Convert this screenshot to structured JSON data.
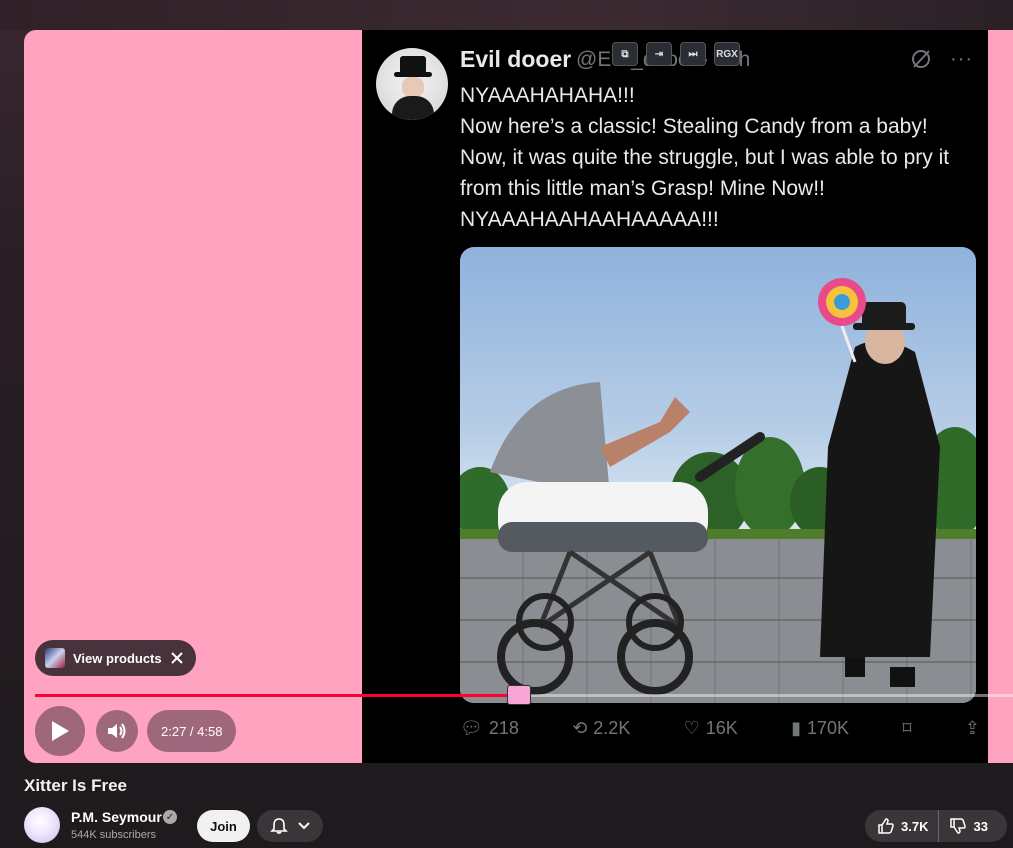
{
  "video": {
    "title": "Xitter Is Free",
    "time": "2:27 / 4:58",
    "progress_fraction": 0.494,
    "products_chip": "View products"
  },
  "overlay_buttons": [
    "⧉",
    "⇥",
    "⏭",
    "RGX"
  ],
  "tweet": {
    "name": "Evil dooer",
    "handle": "@Evil_dooer · 14h",
    "text_line1": "NYAAAHAHAHA!!!",
    "text_body": "Now here’s a classic! Stealing Candy from a baby! Now, it was quite the struggle, but I was able to pry it from this little man’s Grasp! Mine Now!! NYAAAHAAHAAHAAAAA!!!",
    "more": "···",
    "replies": "218",
    "reposts": "2.2K",
    "likes": "16K",
    "views": "170K"
  },
  "channel": {
    "name": "P.M. Seymour",
    "subscribers": "544K subscribers",
    "join_label": "Join"
  },
  "engagement": {
    "likes": "3.7K",
    "dislikes": "33"
  },
  "colors": {
    "player_bg": "#ffa3c0",
    "progress": "#ff0033"
  }
}
